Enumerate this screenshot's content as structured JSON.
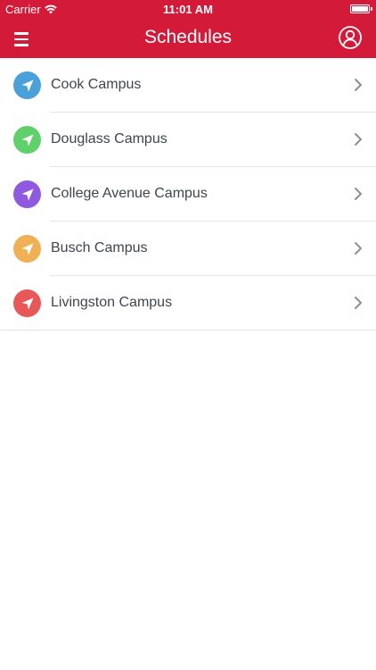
{
  "status_bar": {
    "carrier": "Carrier",
    "time": "11:01 AM",
    "battery_level": 1.0
  },
  "nav": {
    "title": "Schedules",
    "menu_icon": "hamburger-menu-icon",
    "profile_icon": "user-profile-icon"
  },
  "colors": {
    "header": "#d31a38",
    "divider": "#e6e6e6",
    "label": "#3f4550",
    "chevron": "#8e8e93"
  },
  "campuses": [
    {
      "label": "Cook Campus",
      "icon": "navigation-arrow-icon",
      "color": "#4aa0d9"
    },
    {
      "label": "Douglass Campus",
      "icon": "navigation-arrow-icon",
      "color": "#5fd06a"
    },
    {
      "label": "College Avenue Campus",
      "icon": "navigation-arrow-icon",
      "color": "#8f5ae0"
    },
    {
      "label": "Busch Campus",
      "icon": "navigation-arrow-icon",
      "color": "#f0b055"
    },
    {
      "label": "Livingston Campus",
      "icon": "navigation-arrow-icon",
      "color": "#e85858"
    }
  ]
}
